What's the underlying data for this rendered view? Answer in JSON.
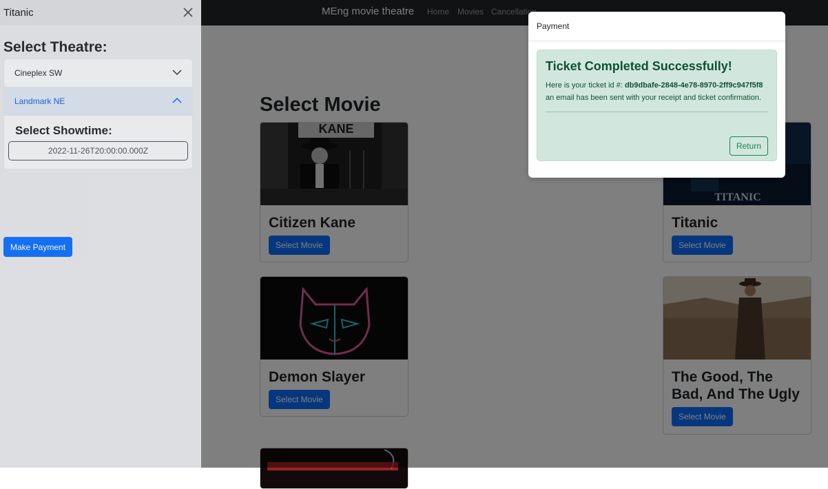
{
  "navbar": {
    "brand": "MEng movie theatre",
    "links": [
      "Home",
      "Movies",
      "Cancellation"
    ]
  },
  "main": {
    "title": "Select Movie",
    "movies": [
      {
        "title": "Citizen Kane",
        "button": "Select Movie"
      },
      {
        "title": "Titanic",
        "button": "Select Movie"
      },
      {
        "title": "Demon Slayer",
        "button": "Select Movie"
      },
      {
        "title": "The Good, The Bad, And The Ugly",
        "button": "Select Movie"
      }
    ]
  },
  "sidebar": {
    "title": "Titanic",
    "heading": "Select Theatre:",
    "theatres": [
      "Cineplex SW",
      "Landmark NE"
    ],
    "showtime_heading": "Select Showtime:",
    "showtime": "2022-11-26T20:00:00.000Z",
    "make_payment": "Make Payment"
  },
  "modal": {
    "title": "Payment",
    "alert_heading": "Ticket Completed Successfully!",
    "text_prefix": "Here is your ticket id #: ",
    "ticket_id": "db9dbafe-2848-4e78-8970-2ff9c947f5f8",
    "text_suffix": " an email has been sent with your receipt and ticket confirmation.",
    "return_label": "Return"
  },
  "colors": {
    "navbar": "#212529",
    "primary": "#0d6efd",
    "success_bg": "#d1e7dd",
    "success_text": "#0f5132"
  }
}
